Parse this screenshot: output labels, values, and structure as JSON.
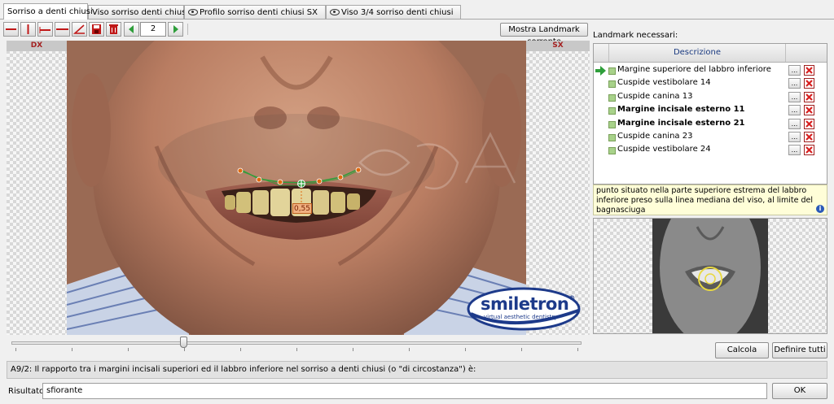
{
  "tabs": [
    {
      "label": "Sorriso a denti chiusi",
      "active": true,
      "has_eye": false
    },
    {
      "label": "Viso sorriso denti chiusi",
      "active": false,
      "has_eye": false
    },
    {
      "label": "Profilo sorriso denti chiusi SX",
      "active": false,
      "has_eye": true
    },
    {
      "label": "Viso 3/4 sorriso denti chiusi",
      "active": false,
      "has_eye": true
    }
  ],
  "toolbar": {
    "tools": [
      "horizontal-line-icon",
      "vertical-line-icon",
      "horizontal-segment-icon",
      "long-horizontal-line-icon",
      "angle-icon",
      "save-icon",
      "trash-icon"
    ],
    "page_value": "2",
    "show_landmark_label": "Mostra Landmark corrente"
  },
  "photo": {
    "left_label": "DX",
    "right_label": "SX",
    "measurement": "0,55",
    "logo_text": "smiletron",
    "logo_reg": "®",
    "logo_tagline": "virtual aesthetic dentistry"
  },
  "slider": {
    "value_fraction": 0.3
  },
  "landmarks": {
    "title": "Landmark necessari:",
    "header": "Descrizione",
    "items": [
      {
        "label": "Margine superiore del labbro inferiore",
        "bold": false,
        "current": true
      },
      {
        "label": "Cuspide vestibolare 14",
        "bold": false,
        "current": false
      },
      {
        "label": "Cuspide canina 13",
        "bold": false,
        "current": false
      },
      {
        "label": "Margine incisale esterno 11",
        "bold": true,
        "current": false
      },
      {
        "label": "Margine incisale esterno 21",
        "bold": true,
        "current": false
      },
      {
        "label": "Cuspide canina 23",
        "bold": false,
        "current": false
      },
      {
        "label": "Cuspide vestibolare 24",
        "bold": false,
        "current": false
      }
    ],
    "dots_label": "...",
    "description": "punto situato nella parte superiore estrema del labbro inferiore preso sulla linea mediana del viso, al limite del bagnasciuga"
  },
  "buttons": {
    "calcola": "Calcola",
    "definire": "Definire tutti",
    "ok": "OK"
  },
  "question": "A9/2: Il rapporto tra i margini incisali superiori ed il labbro inferiore nel sorriso a denti chiusi (o \"di circostanza\") è:",
  "result": {
    "label": "Risultato:",
    "value": "sfiorante"
  },
  "colors": {
    "accent_green": "#2e9e3a",
    "delete_red": "#d82020",
    "landmark_orange": "#e06a10",
    "measure_box": "#f0b080"
  }
}
